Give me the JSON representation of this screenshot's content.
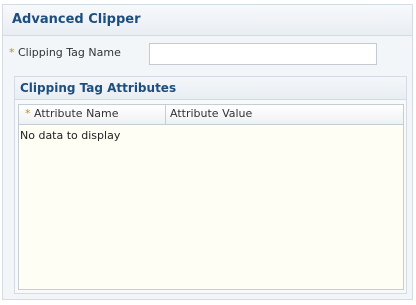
{
  "panel": {
    "title": "Advanced Clipper"
  },
  "form": {
    "required_mark": "*",
    "tag_name_label": "Clipping Tag Name",
    "tag_name_value": ""
  },
  "attributes_section": {
    "title": "Clipping Tag Attributes",
    "columns": [
      {
        "required_mark": "*",
        "label": "Attribute Name"
      },
      {
        "label": "Attribute Value"
      }
    ],
    "empty_message": "No data to display"
  },
  "colors": {
    "title_text": "#1c4e80",
    "required_mark": "#c98c14",
    "panel_bg": "#f3f6f9",
    "table_bg": "#fefef5"
  }
}
